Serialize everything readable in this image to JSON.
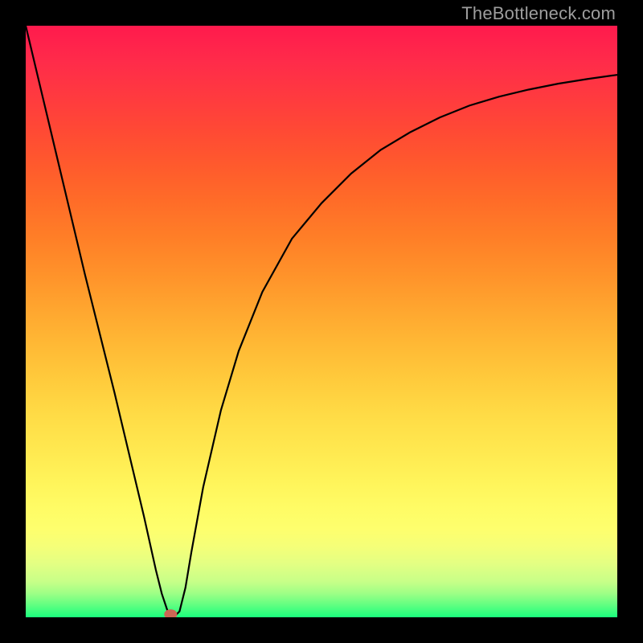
{
  "watermark": {
    "text": "TheBottleneck.com"
  },
  "colors": {
    "background": "#000000",
    "curve_stroke": "#000000",
    "dot_fill": "#cc6655"
  },
  "chart_data": {
    "type": "line",
    "title": "",
    "xlabel": "",
    "ylabel": "",
    "xlim": [
      0,
      100
    ],
    "ylim": [
      0,
      100
    ],
    "grid": false,
    "series": [
      {
        "name": "bottleneck-curve",
        "x": [
          0,
          5,
          10,
          15,
          20,
          22,
          23,
          24,
          25,
          26,
          27,
          28,
          30,
          33,
          36,
          40,
          45,
          50,
          55,
          60,
          65,
          70,
          75,
          80,
          85,
          90,
          95,
          100
        ],
        "values": [
          100,
          79,
          58,
          38,
          17,
          8,
          4,
          1,
          0,
          1,
          5,
          11,
          22,
          35,
          45,
          55,
          64,
          70,
          75,
          79,
          82,
          84.5,
          86.5,
          88,
          89.2,
          90.2,
          91,
          91.7
        ]
      }
    ],
    "annotations": [
      {
        "name": "min-dot",
        "x": 24.5,
        "y": 0.5,
        "color": "#cc6655"
      }
    ]
  }
}
